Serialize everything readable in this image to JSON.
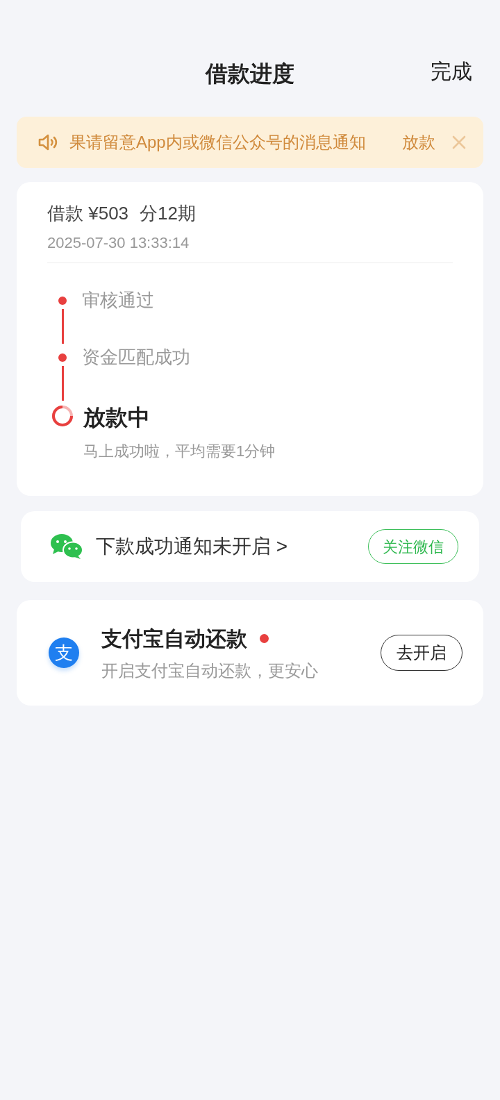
{
  "nav": {
    "title": "借款进度",
    "action": "完成"
  },
  "notice": {
    "segments": [
      "果请留意App内或微信公众号的消息通知",
      "放款"
    ],
    "closable": true
  },
  "loan": {
    "label": "借款",
    "amount": "¥503",
    "installments_prefix": "分",
    "installments": "12",
    "installments_suffix": "期",
    "time": "2025-07-30 13:33:14"
  },
  "steps": [
    {
      "kind": "done",
      "title": "审核通过"
    },
    {
      "kind": "done",
      "title": "资金匹配成功"
    },
    {
      "kind": "current",
      "title": "放款中",
      "note": "马上成功啦，平均需要1分钟"
    }
  ],
  "wechat": {
    "text": "下款成功通知未开启 >",
    "button": "关注微信"
  },
  "alipay": {
    "logo": "支",
    "title": "支付宝自动还款",
    "dot": true,
    "subtitle": "开启支付宝自动还款，更安心",
    "button": "去开启"
  }
}
